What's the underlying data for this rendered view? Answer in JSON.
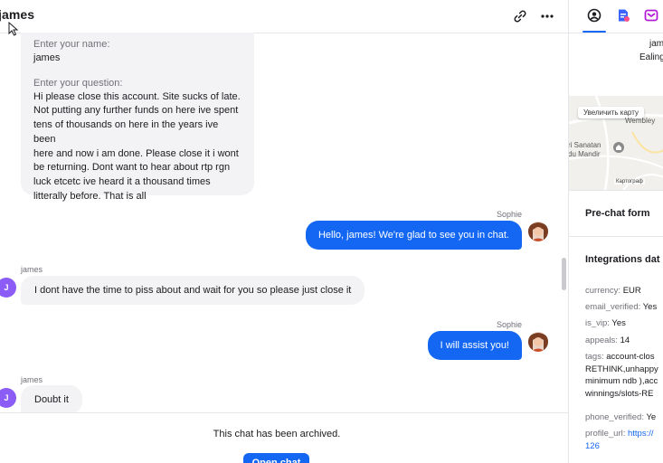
{
  "chat": {
    "title": "james",
    "form": {
      "name_label": "Enter your name:",
      "name_value": "james",
      "question_label": "Enter your question:",
      "question_lines": [
        "Hi please close this account. Site sucks of late.",
        "Not putting any further funds on here ive spent",
        "tens of thousands on here in the years ive been",
        "here and now i am done. Please close it i wont",
        "be returning. Dont want to hear about rtp rgn",
        "luck etcetc ive heard it a thousand times",
        "litterally before. That is all"
      ]
    },
    "messages": [
      {
        "author": "Sophie",
        "text": "Hello, james! We're glad to see you in chat."
      },
      {
        "author": "james",
        "avatar_letter": "J",
        "text": "I dont have the time to piss about and wait for you so please just close it"
      },
      {
        "author": "Sophie",
        "text": "I will assist you!"
      },
      {
        "author": "james",
        "avatar_letter": "J",
        "text": "Doubt it"
      }
    ],
    "archived_text": "This chat has been archived.",
    "open_chat_label": "Open chat",
    "colors": {
      "accent": "#1467f2",
      "customer_avatar": "#8b5cf6",
      "bubble_grey": "#f3f3f5"
    }
  },
  "side": {
    "tabs": [
      "customer-details-icon",
      "ticket-icon",
      "integration-icon"
    ],
    "customer_name": "jam",
    "customer_location": "Ealing",
    "map": {
      "zoom_label": "Увеличить карту",
      "place_1": "Wembley",
      "place_2": "ri Sanatan",
      "place_3": "du Mandir",
      "footer": "Картограф"
    },
    "prechat_title": "Pre-chat form",
    "integrations_title": "Integrations dat",
    "fields": {
      "currency": {
        "k": "currency: ",
        "v": "EUR"
      },
      "email_verified": {
        "k": "email_verified: ",
        "v": "Yes"
      },
      "is_vip": {
        "k": "is_vip: ",
        "v": "Yes"
      },
      "appeals": {
        "k": "appeals: ",
        "v": "14"
      },
      "tags": {
        "k": "tags: ",
        "v1": "account-clos",
        "v2": "RETHINK,unhappy",
        "v3": "minimum ndb ),acc",
        "v4": "winnings/slots-RE"
      },
      "phone_verified": {
        "k": "phone_verified: ",
        "v": "Ye"
      },
      "profile_url": {
        "k": "profile_url: ",
        "v1": "https://",
        "v2": "126"
      }
    }
  }
}
